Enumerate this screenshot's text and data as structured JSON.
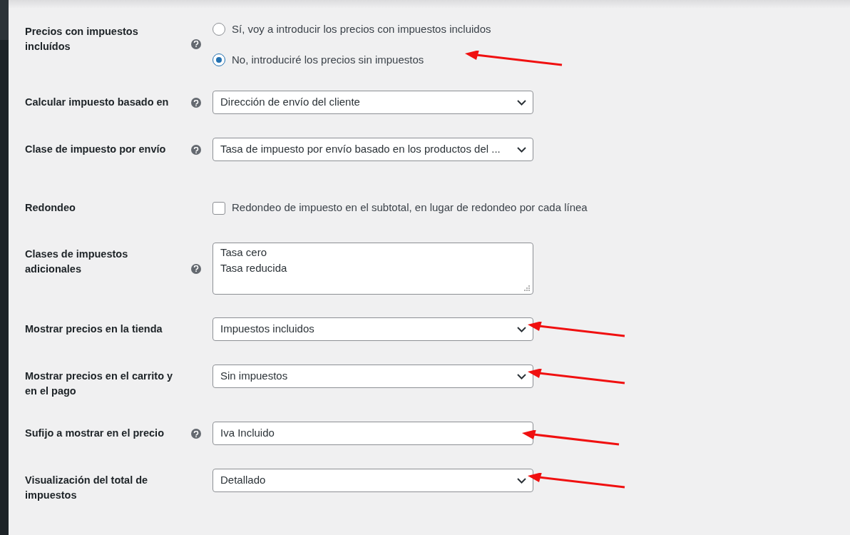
{
  "rows": [
    {
      "kind": "radio",
      "label": "Precios con impuestos incluídos",
      "help": true,
      "arrow": true,
      "options": [
        {
          "label": "Sí, voy a introducir los precios con impuestos incluidos",
          "selected": false
        },
        {
          "label": "No, introduciré los precios sin impuestos",
          "selected": true
        }
      ]
    },
    {
      "kind": "select",
      "label": "Calcular impuesto basado en",
      "help": true,
      "arrow": false,
      "value": "Dirección de envío del cliente"
    },
    {
      "kind": "select",
      "label": "Clase de impuesto por envío",
      "help": true,
      "arrow": false,
      "value": "Tasa de impuesto por envío basado en los productos del ..."
    },
    {
      "kind": "checkbox",
      "label": "Redondeo",
      "help": false,
      "arrow": false,
      "text": "Redondeo de impuesto en el subtotal, en lugar de redondeo por cada línea",
      "checked": false
    },
    {
      "kind": "textarea",
      "label": "Clases de impuestos adicionales",
      "help": true,
      "arrow": false,
      "lines": [
        "Tasa cero",
        "Tasa reducida"
      ]
    },
    {
      "kind": "select",
      "label": "Mostrar precios en la tienda",
      "help": false,
      "arrow": true,
      "value": "Impuestos incluidos"
    },
    {
      "kind": "select",
      "label": "Mostrar precios en el carrito y en el pago",
      "help": false,
      "arrow": true,
      "value": "Sin impuestos"
    },
    {
      "kind": "text",
      "label": "Sufijo a mostrar en el precio",
      "help": true,
      "arrow": true,
      "value": "Iva Incluido"
    },
    {
      "kind": "select",
      "label": "Visualización del total de impuestos",
      "help": false,
      "arrow": true,
      "value": "Detallado"
    }
  ]
}
